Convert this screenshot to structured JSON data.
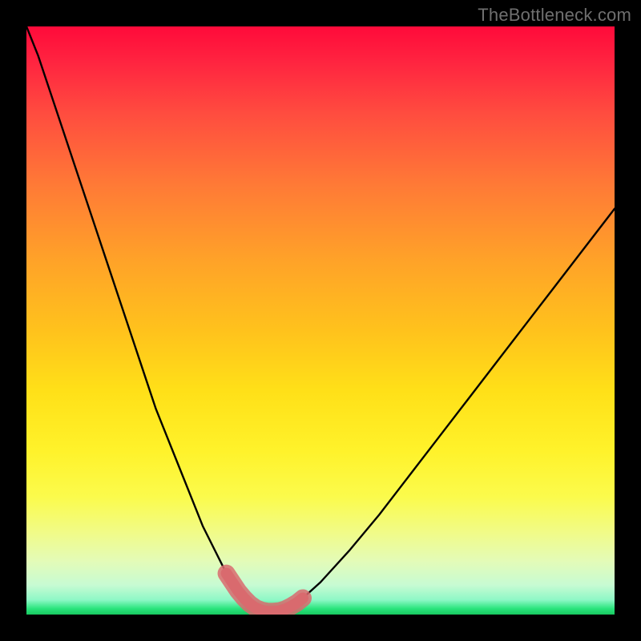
{
  "watermark": "TheBottleneck.com",
  "colors": {
    "page_bg": "#000000",
    "curve": "#000000",
    "highlight": "#d96a6e",
    "gradient_top": "#ff0a3a",
    "gradient_bottom": "#18c860"
  },
  "chart_data": {
    "type": "line",
    "title": "",
    "xlabel": "",
    "ylabel": "",
    "xlim": [
      0,
      100
    ],
    "ylim": [
      0,
      100
    ],
    "grid": false,
    "legend": false,
    "series": [
      {
        "name": "bottleneck-curve",
        "x": [
          0,
          2,
          4,
          6,
          8,
          10,
          12,
          14,
          16,
          18,
          20,
          22,
          24,
          26,
          28,
          30,
          32,
          33,
          34,
          35,
          36,
          37,
          38,
          39,
          40,
          41,
          42,
          43,
          44,
          45,
          47,
          50,
          55,
          60,
          65,
          70,
          75,
          80,
          85,
          90,
          95,
          100
        ],
        "y": [
          100,
          95,
          89,
          83,
          77,
          71,
          65,
          59,
          53,
          47,
          41,
          35,
          30,
          25,
          20,
          15,
          11,
          9,
          7,
          5.5,
          4,
          2.8,
          1.8,
          1.1,
          0.7,
          0.5,
          0.5,
          0.6,
          0.9,
          1.4,
          2.8,
          5.5,
          11,
          17,
          23.5,
          30,
          36.5,
          43,
          49.5,
          56,
          62.5,
          69
        ]
      }
    ],
    "annotations": [
      {
        "name": "highlight-minimum",
        "shape": "path",
        "x": [
          34,
          35,
          36,
          37,
          38,
          39,
          40,
          41,
          42,
          43,
          44,
          45,
          46,
          47
        ],
        "y": [
          7,
          5.5,
          4,
          2.8,
          1.8,
          1.1,
          0.7,
          0.5,
          0.5,
          0.6,
          0.9,
          1.4,
          2.0,
          2.8
        ]
      }
    ]
  }
}
